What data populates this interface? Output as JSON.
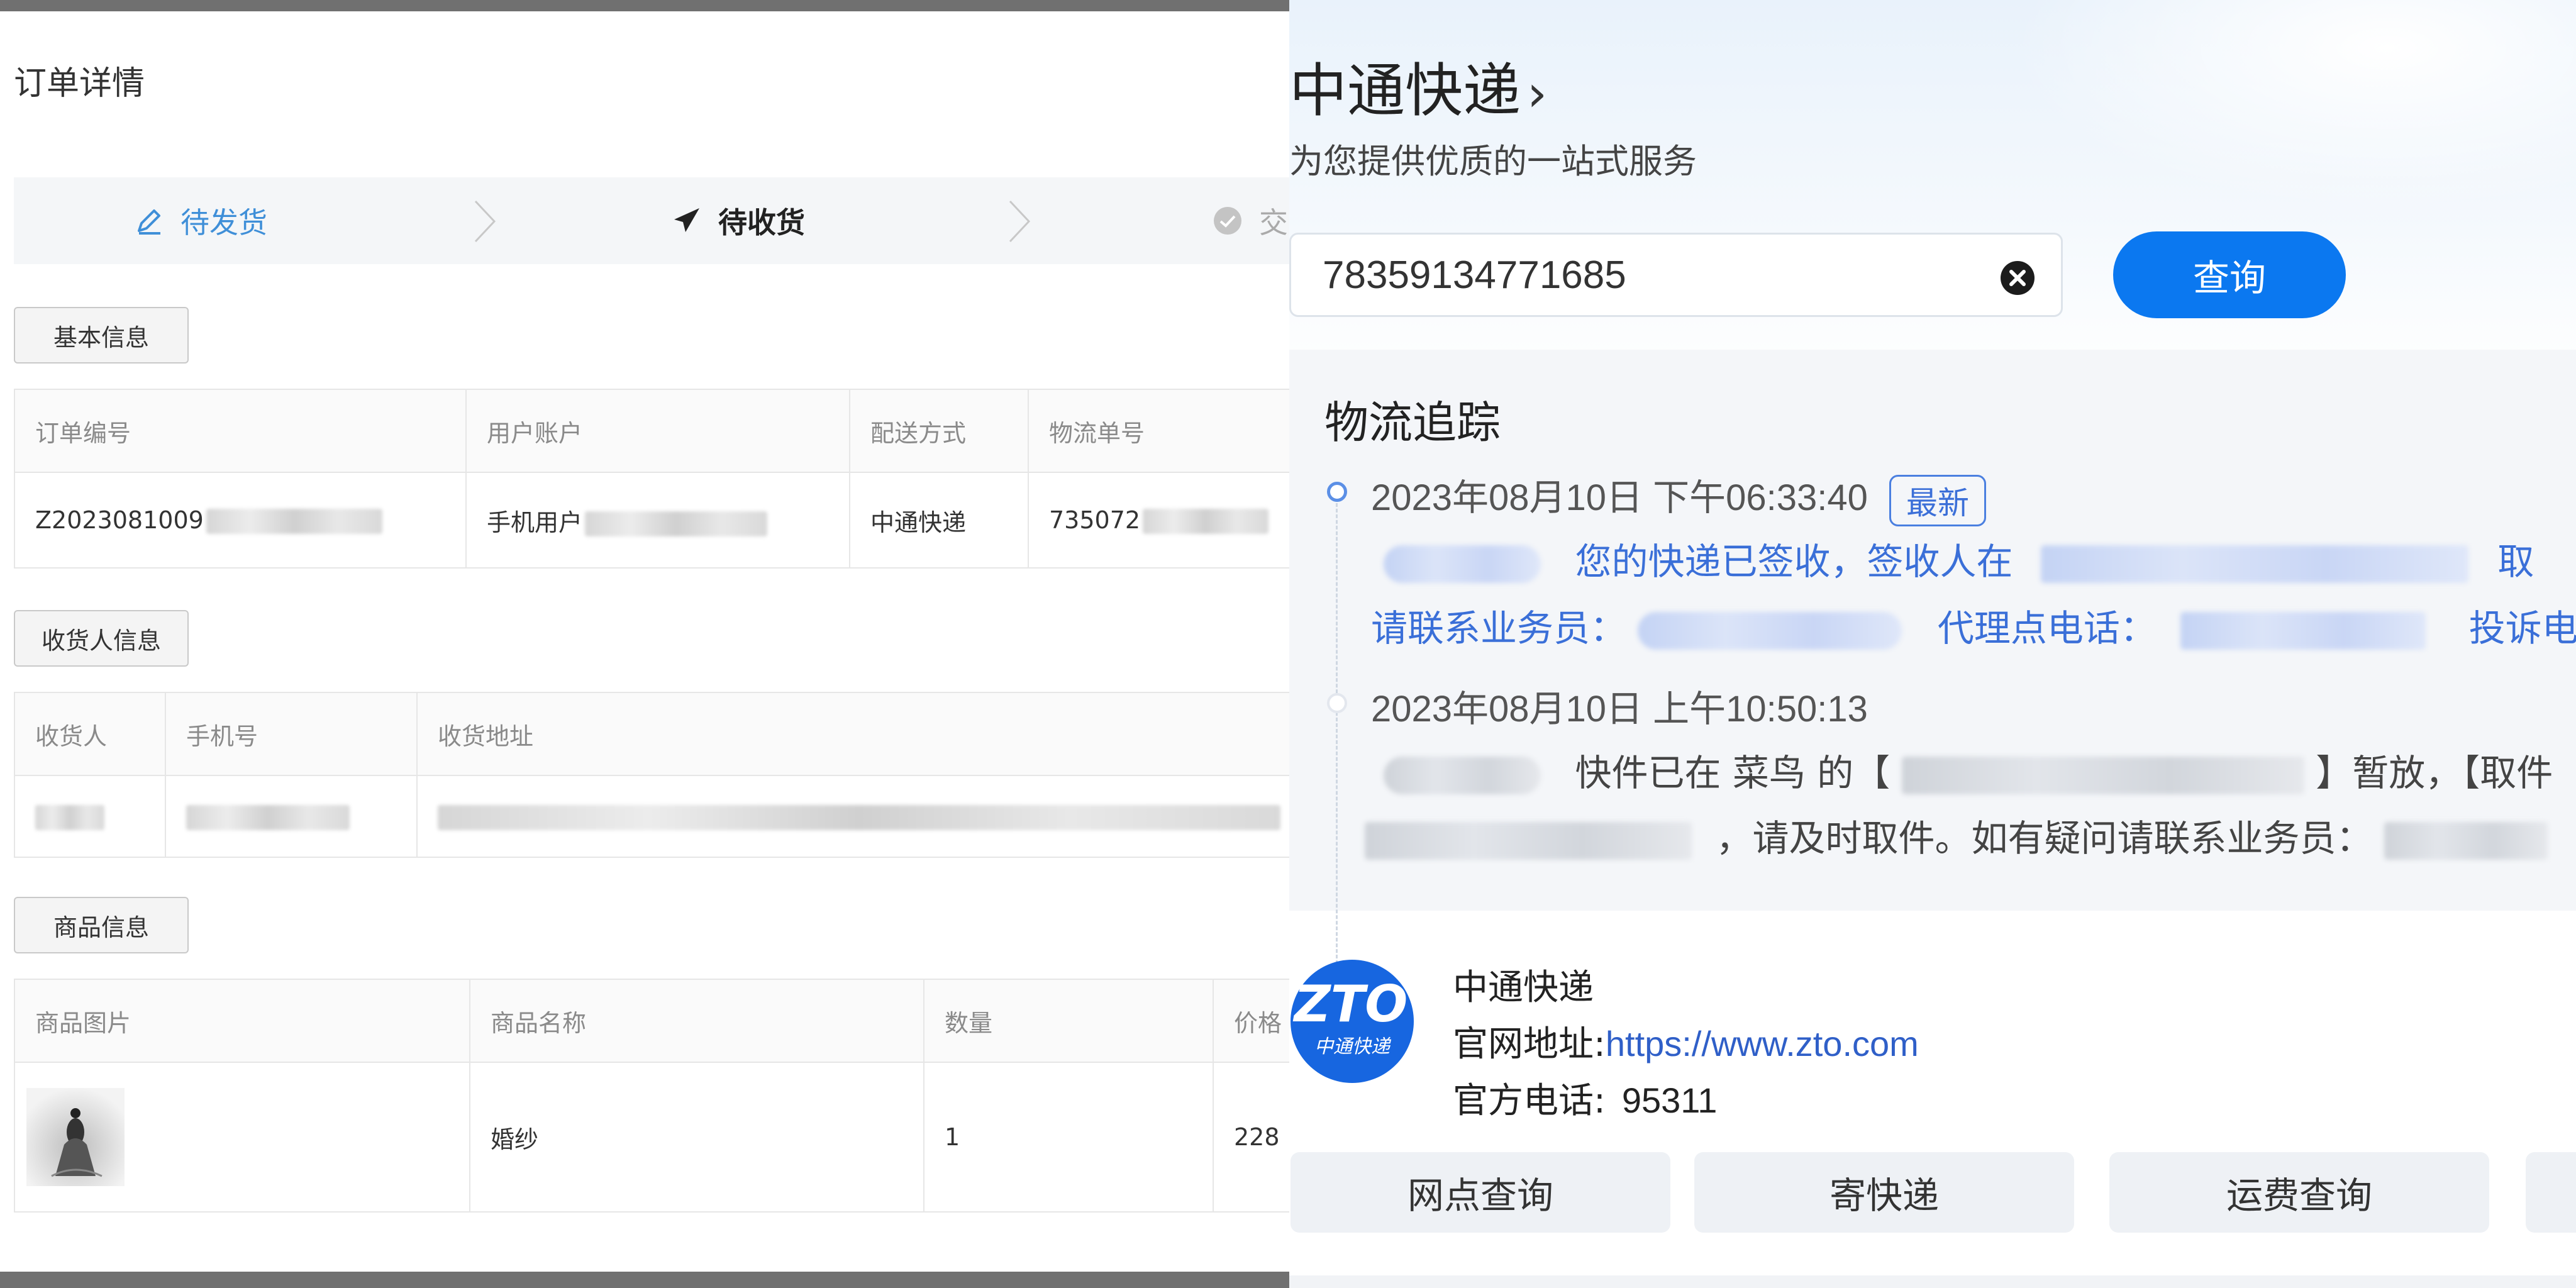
{
  "order": {
    "page_title": "订单详情",
    "steps": [
      {
        "label": "待发货",
        "icon": "pen-icon",
        "state": "done"
      },
      {
        "label": "待收货",
        "icon": "paper-plane-icon",
        "state": "current"
      },
      {
        "label": "交",
        "icon": "check-circle-icon",
        "state": "pending"
      }
    ],
    "basic_info": {
      "section_label": "基本信息",
      "headers": [
        "订单编号",
        "用户账户",
        "配送方式",
        "物流单号"
      ],
      "row": {
        "order_no": "Z2023081009",
        "account": "手机用户",
        "shipping": "中通快递",
        "tracking_no": "735072"
      }
    },
    "receiver_info": {
      "section_label": "收货人信息",
      "headers": [
        "收货人",
        "手机号",
        "收货地址"
      ]
    },
    "goods_info": {
      "section_label": "商品信息",
      "headers": [
        "商品图片",
        "商品名称",
        "数量",
        "价格"
      ],
      "row": {
        "name": "婚纱",
        "qty": "1",
        "price": "228"
      }
    }
  },
  "zto": {
    "title": "中通快递",
    "title_arrow": "›",
    "subtitle": "为您提供优质的一站式服务",
    "search_value": "78359134771685",
    "query_button": "查询",
    "tracking_title": "物流追踪",
    "events": [
      {
        "time": "2023年08月10日 下午06:33:40",
        "badge": "最新",
        "line1_a": "您的快递已签收，签收人在",
        "line1_b": "取",
        "line2_a": "请联系业务员：",
        "line2_b": "代理点电话：",
        "line2_c": "投诉电"
      },
      {
        "time": "2023年08月10日 上午10:50:13",
        "line1_a": "快件已在 菜鸟 的【",
        "line1_b": "】暂放，【取件",
        "line2_a": "，请及时取件。如有疑问请联系业务员："
      }
    ],
    "company": {
      "name": "中通快递",
      "site_label": "官网地址:",
      "site_url": "https://www.zto.com",
      "tel_label": "官方电话:",
      "tel": "95311"
    },
    "actions": [
      "网点查询",
      "寄快递",
      "运费查询"
    ],
    "colors": {
      "brand_blue": "#0b78f0",
      "step_blue": "#3f8fd8"
    }
  }
}
